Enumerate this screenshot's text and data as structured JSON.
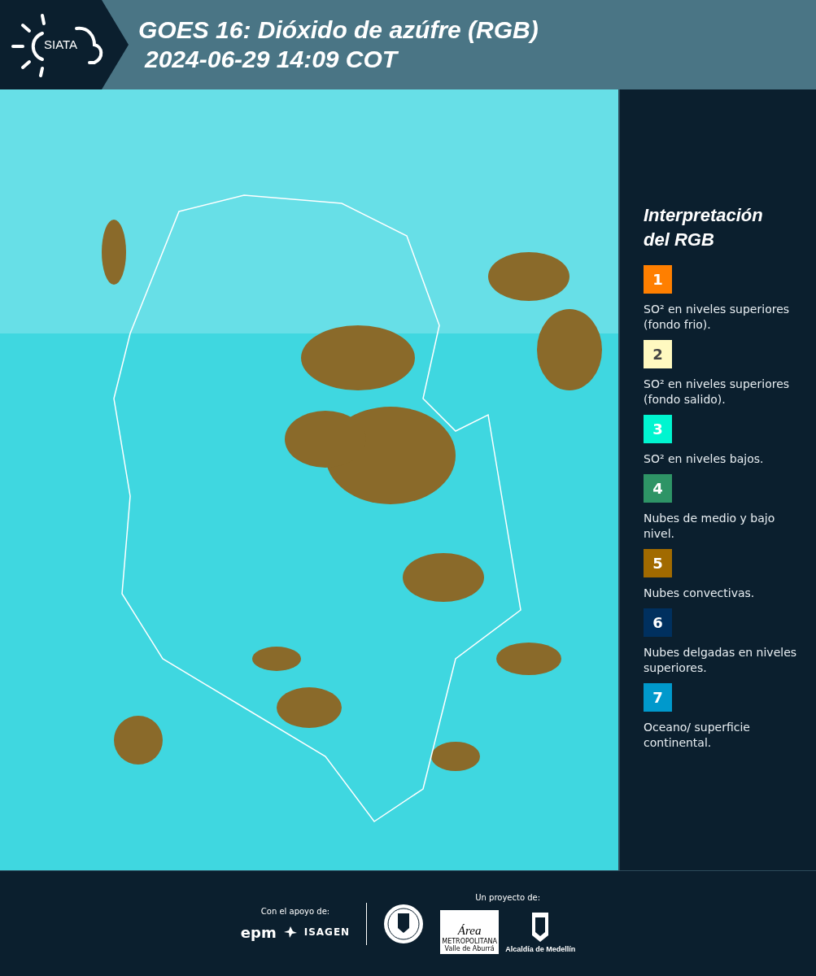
{
  "header": {
    "logo_text": "SIATA",
    "title": "GOES 16: Dióxido de azúfre (RGB)",
    "subtitle": "2024-06-29 14:09 COT"
  },
  "legend": {
    "title": "Interpretación del RGB",
    "items": [
      {
        "number": "1",
        "color": "#ff7f00",
        "text": "SO² en niveles superiores (fondo frio)."
      },
      {
        "number": "2",
        "color": "#fff9c0",
        "text": "SO² en niveles superiores (fondo salido)."
      },
      {
        "number": "3",
        "color": "#00f5d0",
        "text": "SO² en niveles bajos."
      },
      {
        "number": "4",
        "color": "#2e9466",
        "text": "Nubes de medio y bajo nivel."
      },
      {
        "number": "5",
        "color": "#a16a00",
        "text": "Nubes convectivas."
      },
      {
        "number": "6",
        "color": "#00305f",
        "text": "Nubes delgadas en niveles superiores."
      },
      {
        "number": "7",
        "color": "#0099cc",
        "text": "Oceano/ superficie continental."
      }
    ]
  },
  "footer": {
    "support_label": "Con el apoyo de:",
    "support_logos": [
      "epm",
      "ISAGEN"
    ],
    "project_label": "Un proyecto de:",
    "area_logo": {
      "title": "Área",
      "line1": "METROPOLITANA",
      "line2": "Valle de Aburrá"
    },
    "alcaldia": "Alcaldía de Medellín"
  }
}
